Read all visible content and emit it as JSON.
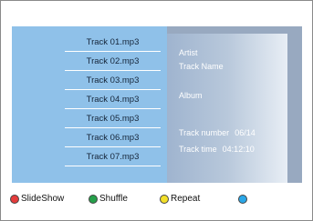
{
  "tracks": [
    {
      "label": "Track 01.mp3"
    },
    {
      "label": "Track 02.mp3"
    },
    {
      "label": "Track 03.mp3"
    },
    {
      "label": "Track 04.mp3"
    },
    {
      "label": "Track 05.mp3"
    },
    {
      "label": "Track 06.mp3"
    },
    {
      "label": "Track 07.mp3"
    }
  ],
  "info": {
    "artist_label": "Artist",
    "track_name_label": "Track Name",
    "album_label": "Album",
    "track_number_label": "Track number",
    "track_number_value": "06/14",
    "track_time_label": "Track time",
    "track_time_value": "04:12:10"
  },
  "controls": {
    "red": {
      "label": "SlideShow",
      "color": "#e43c3c",
      "icon": "red-button-icon"
    },
    "green": {
      "label": "Shuffle",
      "color": "#25a04a",
      "icon": "green-button-icon"
    },
    "yellow": {
      "label": "Repeat",
      "color": "#f2df29",
      "icon": "yellow-button-icon"
    },
    "blue": {
      "color": "#2aa7e8",
      "icon": "blue-button-icon"
    }
  },
  "colors": {
    "list_background": "#8fc1e9",
    "panel_background": "#98a9c0"
  }
}
